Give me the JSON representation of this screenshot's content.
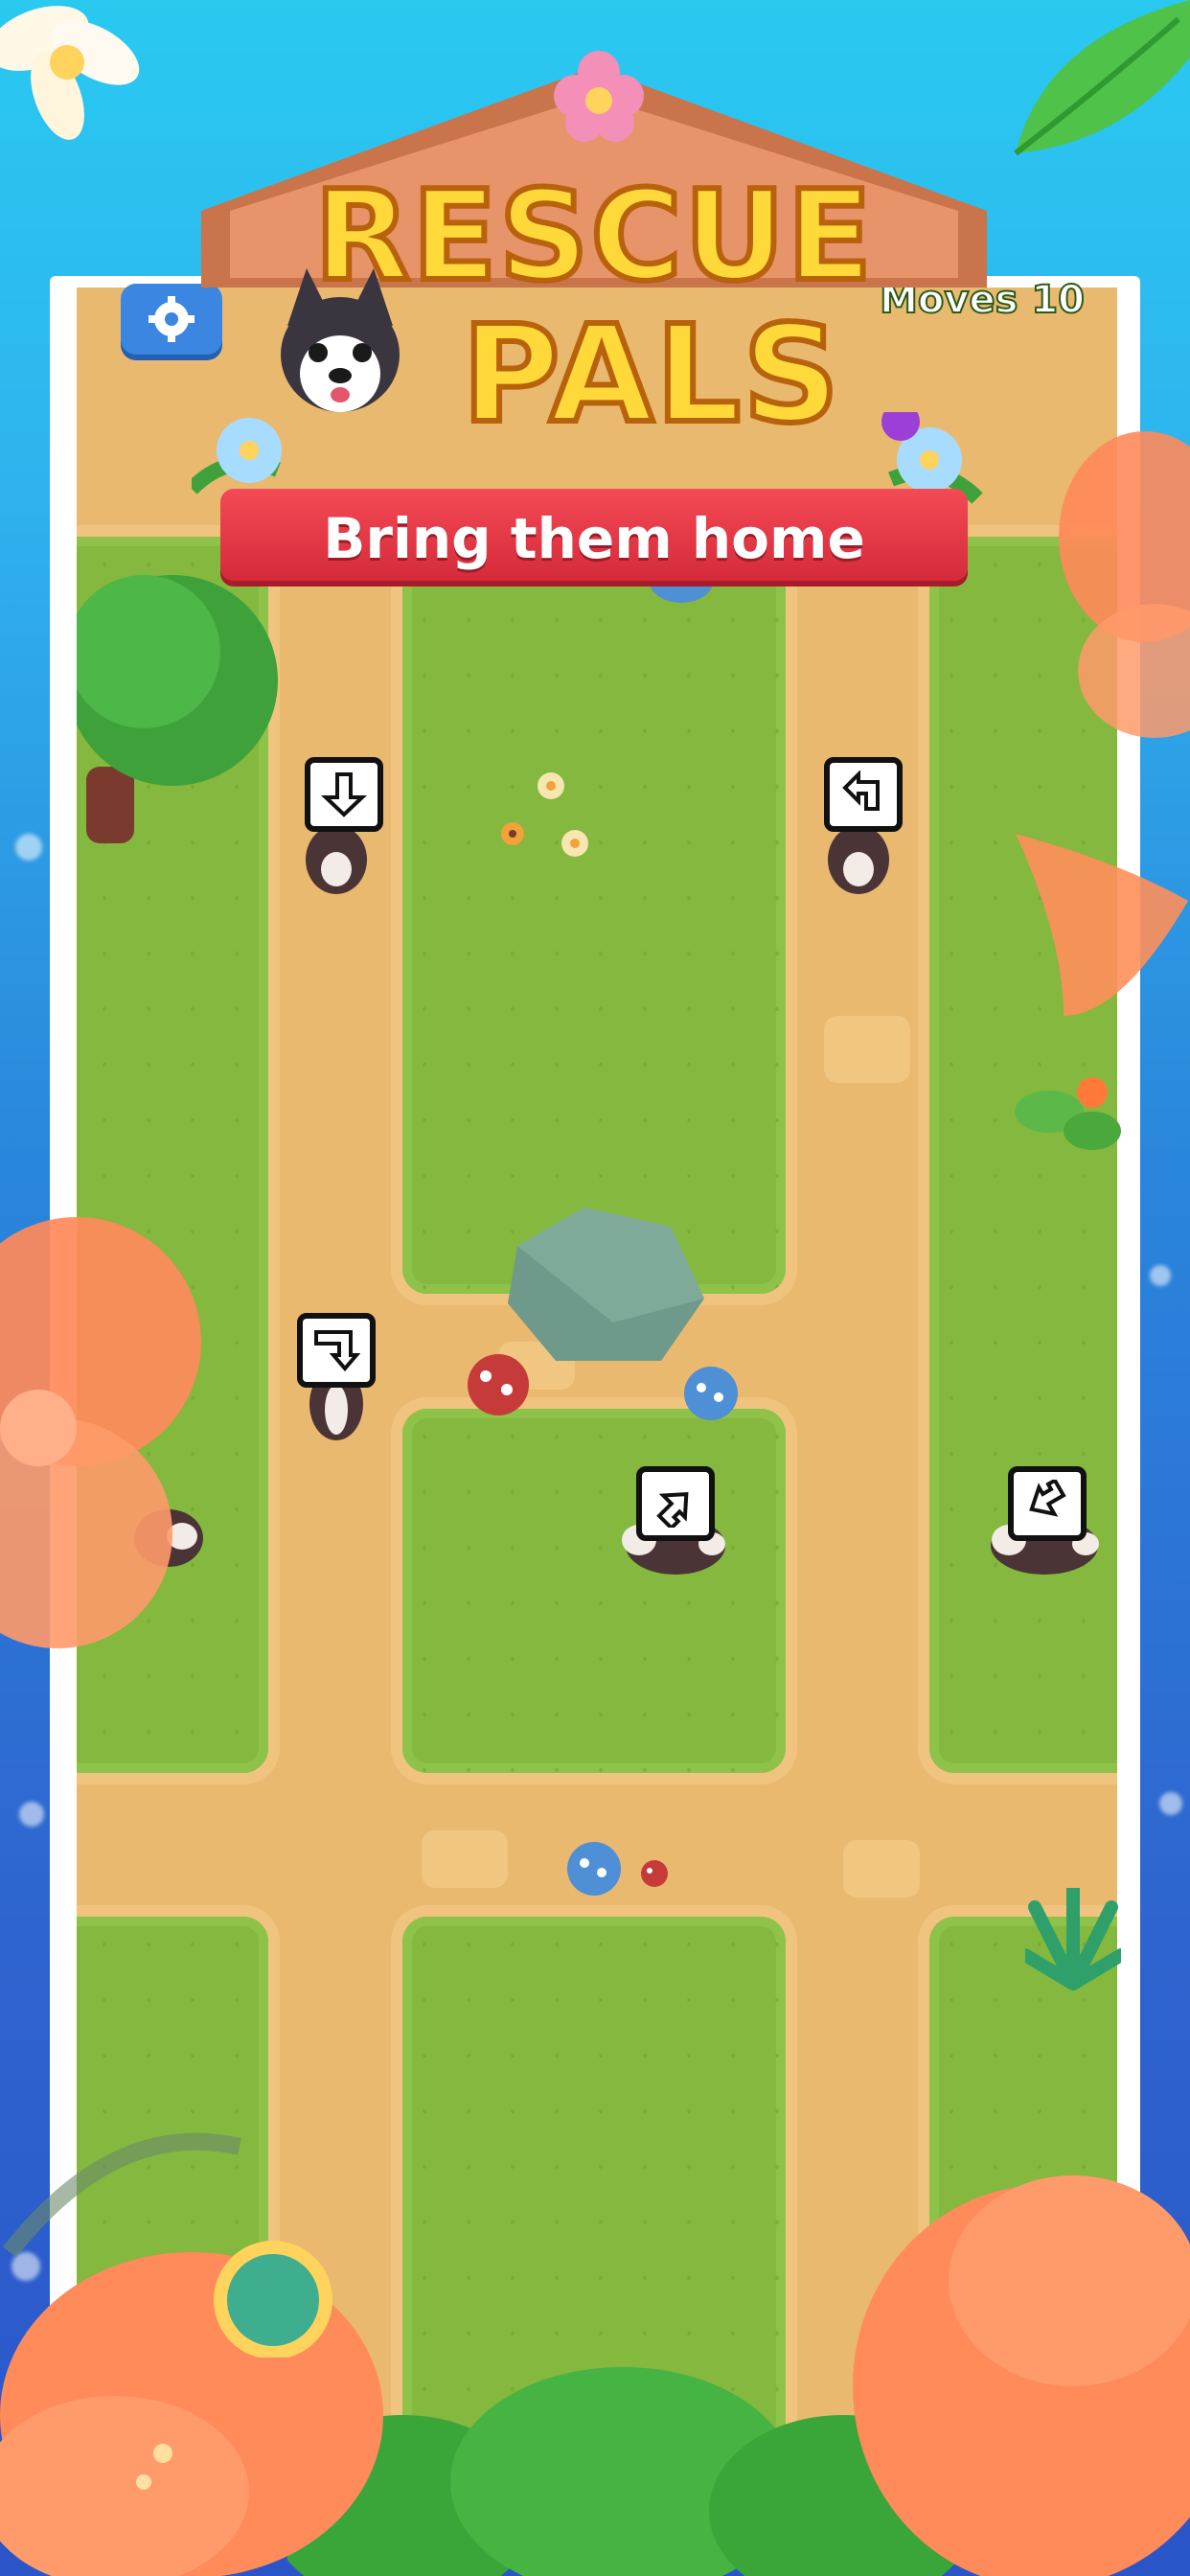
{
  "game": {
    "title_line1": "RESCUE",
    "title_line2": "PALS",
    "tagline": "Bring them home",
    "moves_label": "Moves 10"
  },
  "icons": {
    "settings": "gear-icon",
    "dog": "husky-puppy-icon",
    "arrow_down": "arrow-down-icon",
    "arrow_uturn_down": "arrow-uturn-down-icon",
    "arrow_uturn_left": "arrow-uturn-left-icon",
    "arrow_turn_right_up": "arrow-turn-up-right-icon",
    "arrow_turn_left_down": "arrow-turn-down-left-icon"
  },
  "colors": {
    "grass": "#84b83e",
    "path": "#e9b970",
    "logo_yellow": "#ffd83a",
    "ribbon_red": "#e23746",
    "settings_blue": "#3a86e0"
  }
}
